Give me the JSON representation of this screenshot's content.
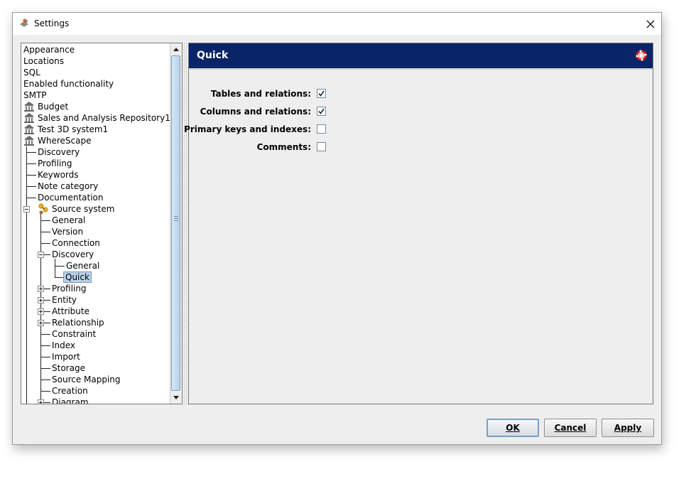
{
  "window": {
    "title": "Settings",
    "icon": "app-logo-icon",
    "close": "close-icon"
  },
  "tree": {
    "items": [
      {
        "label": "Appearance"
      },
      {
        "label": "Locations"
      },
      {
        "label": "SQL"
      },
      {
        "label": "Enabled functionality"
      },
      {
        "label": "SMTP"
      },
      {
        "label": "Budget",
        "icon": "repository-icon"
      },
      {
        "label": "Sales and Analysis Repository1",
        "icon": "repository-icon"
      },
      {
        "label": "Test 3D system1",
        "icon": "repository-icon"
      },
      {
        "label": "WhereScape",
        "icon": "repository-icon"
      },
      {
        "label": "Discovery"
      },
      {
        "label": "Profiling"
      },
      {
        "label": "Keywords"
      },
      {
        "label": "Note category"
      },
      {
        "label": "Documentation"
      },
      {
        "label": "Source system",
        "icon": "source-system-icon",
        "expanded": true
      },
      {
        "label": "General"
      },
      {
        "label": "Version"
      },
      {
        "label": "Connection"
      },
      {
        "label": "Discovery",
        "expanded": true
      },
      {
        "label": "General"
      },
      {
        "label": "Quick",
        "selected": true
      },
      {
        "label": "Profiling",
        "expanded": false
      },
      {
        "label": "Entity",
        "expanded": false
      },
      {
        "label": "Attribute",
        "expanded": false
      },
      {
        "label": "Relationship",
        "expanded": false
      },
      {
        "label": "Constraint"
      },
      {
        "label": "Index"
      },
      {
        "label": "Import"
      },
      {
        "label": "Storage"
      },
      {
        "label": "Source Mapping"
      },
      {
        "label": "Creation"
      },
      {
        "label": "Diagram",
        "expanded": false
      }
    ]
  },
  "content": {
    "title": "Quick",
    "help_icon": "help-lifebuoy-icon",
    "options": [
      {
        "label": "Tables and relations:",
        "checked": true
      },
      {
        "label": "Columns and relations:",
        "checked": true
      },
      {
        "label": "Primary keys and indexes:",
        "checked": false
      },
      {
        "label": "Comments:",
        "checked": false
      }
    ]
  },
  "buttons": {
    "ok": "OK",
    "cancel": "Cancel",
    "apply": "Apply"
  },
  "colors": {
    "header_bg": "#0a2468",
    "selection": "#b8cfe5",
    "window_bg": "#eeeeee"
  }
}
